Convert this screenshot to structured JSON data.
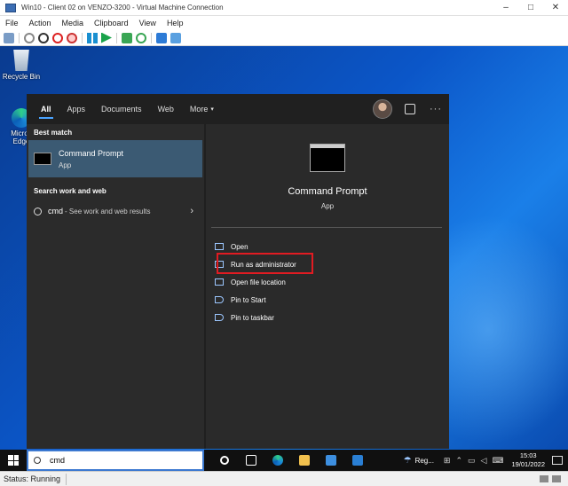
{
  "window": {
    "title": "Win10 - Client 02 on VENZO-3200 - Virtual Machine Connection"
  },
  "window_controls": [
    "–",
    "□",
    "✕"
  ],
  "menu": [
    "File",
    "Action",
    "Media",
    "Clipboard",
    "View",
    "Help"
  ],
  "desktop": {
    "icons": [
      {
        "label": "Recycle Bin",
        "icon": "recycle-bin-icon"
      },
      {
        "label": "Micros Edge",
        "icon": "edge-icon"
      }
    ]
  },
  "start_menu": {
    "tabs": [
      "All",
      "Apps",
      "Documents",
      "Web",
      "More"
    ],
    "active_tab": "All",
    "more_caret": "▾",
    "more_options": "···",
    "best_match_header": "Best match",
    "best_match": {
      "name": "Command Prompt",
      "type": "App"
    },
    "search_web_header": "Search work and web",
    "web_result": {
      "query": "cmd",
      "hint": "- See work and web results",
      "chevron": "›"
    },
    "preview": {
      "name": "Command Prompt",
      "type": "App"
    },
    "actions": [
      {
        "label": "Open",
        "icon": "open-icon"
      },
      {
        "label": "Run as administrator",
        "icon": "run-as-admin-icon"
      },
      {
        "label": "Open file location",
        "icon": "folder-location-icon"
      },
      {
        "label": "Pin to Start",
        "icon": "pin-icon"
      },
      {
        "label": "Pin to taskbar",
        "icon": "pin-icon"
      }
    ]
  },
  "taskbar": {
    "search_value": "cmd",
    "weather": "Reg...",
    "time": "15:03",
    "date": "19/01/2022",
    "colors": {
      "accent": "#3b78d0",
      "highlight_box": "#e11b22"
    }
  },
  "status": {
    "text": "Status: Running"
  }
}
